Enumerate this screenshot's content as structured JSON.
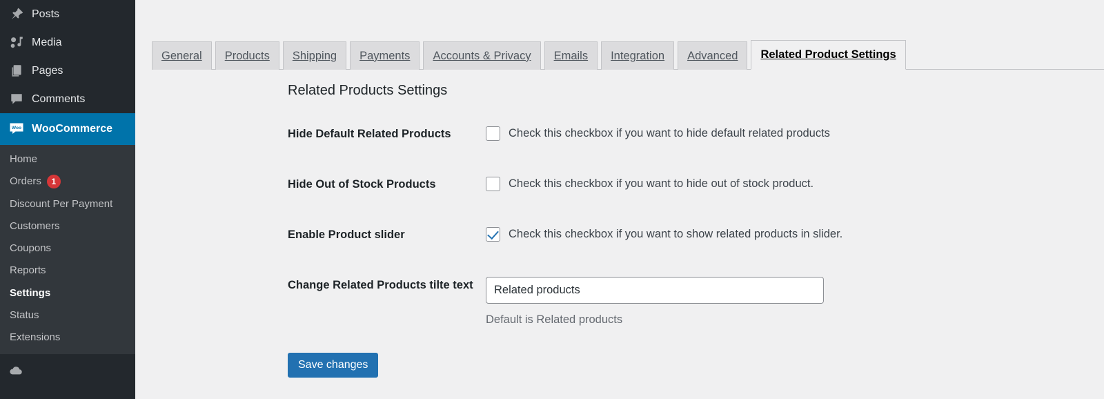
{
  "sidebar": {
    "top_items": [
      {
        "label": "Posts",
        "icon": "pin-icon"
      },
      {
        "label": "Media",
        "icon": "media-icon"
      },
      {
        "label": "Pages",
        "icon": "pages-icon"
      },
      {
        "label": "Comments",
        "icon": "comment-bubble-icon"
      }
    ],
    "current_item": {
      "label": "WooCommerce",
      "icon": "woocommerce-icon",
      "accent": "#0073aa"
    },
    "submenu": [
      {
        "label": "Home",
        "badge": null,
        "current": false
      },
      {
        "label": "Orders",
        "badge": "1",
        "current": false
      },
      {
        "label": "Discount Per Payment",
        "badge": null,
        "current": false
      },
      {
        "label": "Customers",
        "badge": null,
        "current": false
      },
      {
        "label": "Coupons",
        "badge": null,
        "current": false
      },
      {
        "label": "Reports",
        "badge": null,
        "current": false
      },
      {
        "label": "Settings",
        "badge": null,
        "current": true
      },
      {
        "label": "Status",
        "badge": null,
        "current": false
      },
      {
        "label": "Extensions",
        "badge": null,
        "current": false
      }
    ],
    "badge_color": "#d63638"
  },
  "tabs": [
    {
      "label": "General",
      "active": false
    },
    {
      "label": "Products",
      "active": false
    },
    {
      "label": "Shipping",
      "active": false
    },
    {
      "label": "Payments",
      "active": false
    },
    {
      "label": "Accounts & Privacy",
      "active": false
    },
    {
      "label": "Emails",
      "active": false
    },
    {
      "label": "Integration",
      "active": false
    },
    {
      "label": "Advanced",
      "active": false
    },
    {
      "label": "Related Product Settings",
      "active": true
    }
  ],
  "page": {
    "heading": "Related Products Settings"
  },
  "form": {
    "rows": [
      {
        "label": "Hide Default Related Products",
        "type": "checkbox",
        "checked": false,
        "text": "Check this checkbox if you want to hide default related products"
      },
      {
        "label": "Hide Out of Stock Products",
        "type": "checkbox",
        "checked": false,
        "text": "Check this checkbox if you want to hide out of stock product."
      },
      {
        "label": "Enable Product slider",
        "type": "checkbox",
        "checked": true,
        "text": "Check this checkbox if you want to show related products in slider."
      },
      {
        "label": "Change Related Products tilte text",
        "type": "text",
        "value": "Related products",
        "placeholder": "",
        "description": "Default is Related products"
      }
    ]
  },
  "submit": {
    "label": "Save changes",
    "color": "#2271b1"
  }
}
